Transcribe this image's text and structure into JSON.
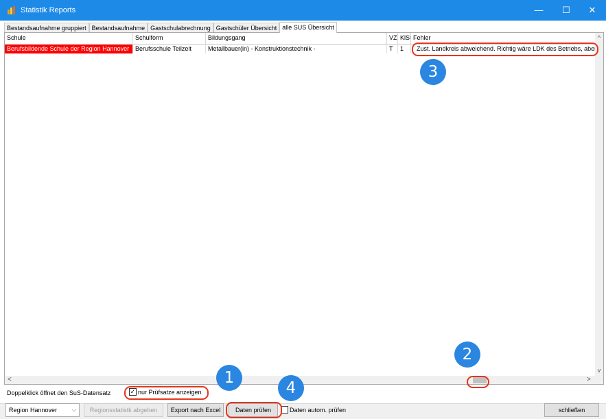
{
  "window": {
    "title": "Statistik Reports",
    "controls": {
      "minimize": "—",
      "maximize": "☐",
      "close": "✕"
    }
  },
  "tabs": [
    {
      "label": "Bestandsaufnahme gruppiert"
    },
    {
      "label": "Bestandsaufnahme"
    },
    {
      "label": "Gastschulabrechnung"
    },
    {
      "label": "Gastschüler Übersicht"
    },
    {
      "label": "alle SUS Übersicht",
      "active": true
    }
  ],
  "grid": {
    "columns": [
      "Schule",
      "Schulform",
      "Bildungsgang",
      "VZ",
      "KlSt",
      "Fehler"
    ],
    "rows": [
      {
        "schule": "Berufsbildende Schule der Region Hannover",
        "schulform": "Berufsschule Teilzeit",
        "bildungsgang": "Metallbauer(in) - Konstruktionstechnik -",
        "vz": "T",
        "klst": "1",
        "fehler": "Zust. Landkreis abweichend. Richtig wäre LDK des Betriebs, aber"
      }
    ],
    "scroll_left": "<",
    "scroll_right": ">",
    "scroll_up": "^",
    "scroll_down": "v"
  },
  "footer": {
    "hint": "Doppelklick öffnet den SuS-Datensatz",
    "only_checks_label": "nur Prüfsatze anzeigen",
    "only_checks_checked": true,
    "auto_check_label": "Daten autom. prüfen",
    "auto_check_checked": false,
    "region_select": "Region Hannover",
    "btn_submit": "Regionsstatistk abgeben",
    "btn_export": "Export nach Excel",
    "btn_check": "Daten prüfen",
    "btn_close": "schließen"
  },
  "annotations": [
    "1",
    "2",
    "3",
    "4"
  ],
  "colors": {
    "titlebar": "#1e8ae8",
    "error_cell": "#ff0000",
    "marker": "#2a86e0",
    "highlight": "#e8341c"
  }
}
